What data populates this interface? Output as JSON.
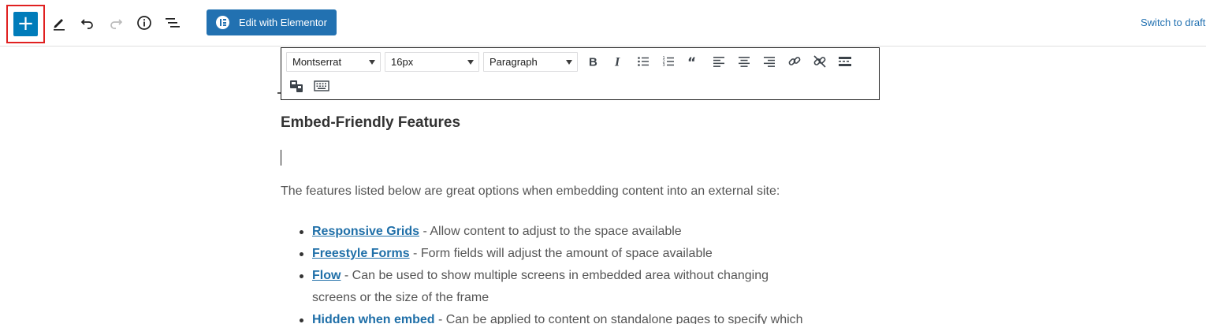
{
  "toolbar": {
    "add_block_label": "+",
    "elementor_label": "Edit with Elementor",
    "switch_to_draft": "Switch to draft"
  },
  "editor_toolbar": {
    "font_family": "Montserrat",
    "font_size": "16px",
    "format": "Paragraph"
  },
  "content": {
    "heading": "Embed-Friendly Features",
    "intro": "The features listed below are great options when embedding content into an external site:",
    "features": [
      {
        "link": "Responsive Grids",
        "text": " - Allow content to adjust to the space available"
      },
      {
        "link": "Freestyle Forms",
        "text": " - Form fields will adjust the amount of space available"
      },
      {
        "link": "Flow",
        "text": " - Can be used to show multiple screens in embedded area without changing",
        "text_cont": "screens or the size of the frame"
      },
      {
        "link": "Hidden when embed",
        "text": "  - Can be applied to content on standalone pages to specify which"
      }
    ]
  },
  "colors": {
    "accent": "#007cba",
    "elementor": "#2271b1",
    "highlight_border": "#e02020",
    "link": "#1f6fa8"
  }
}
